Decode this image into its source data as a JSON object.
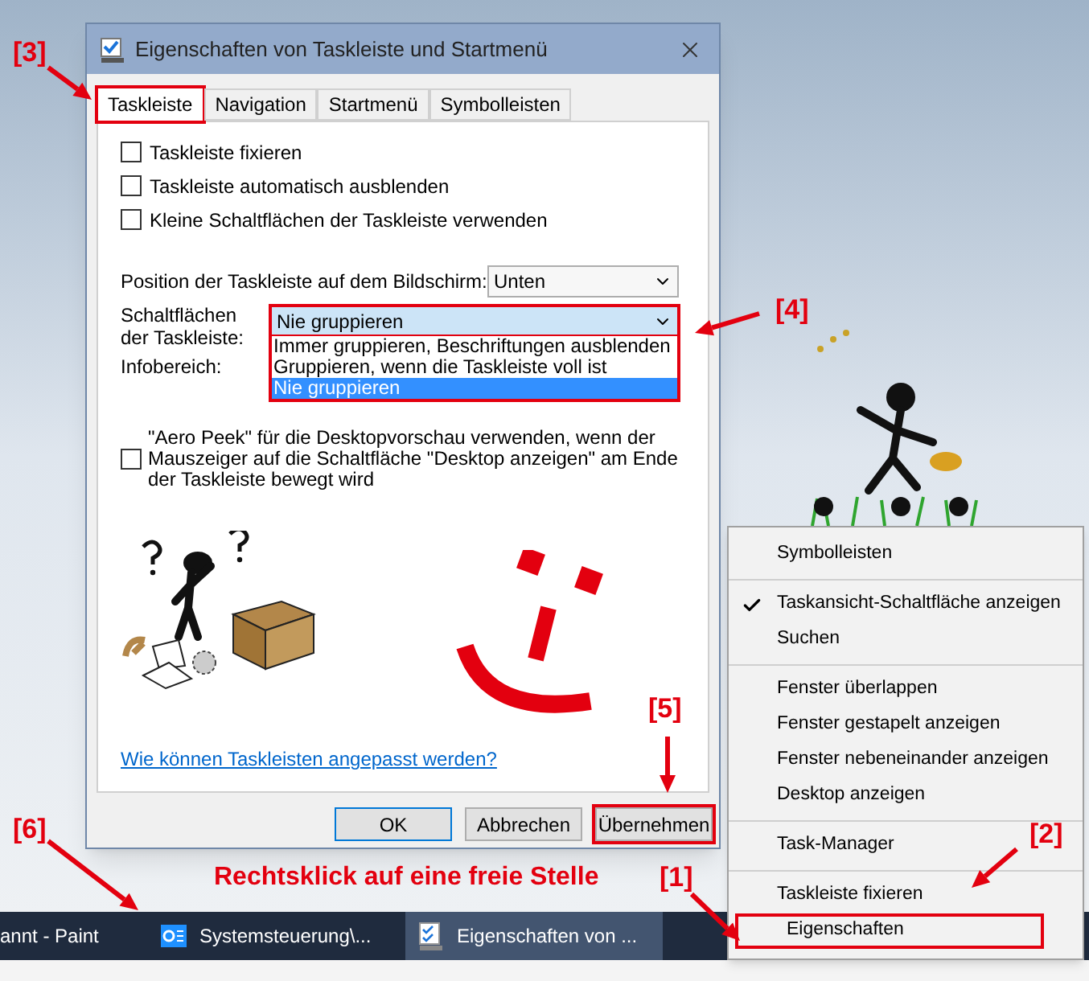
{
  "dialog": {
    "title": "Eigenschaften von Taskleiste und Startmenü",
    "tabs": [
      {
        "label": "Taskleiste",
        "selected": true,
        "marked": true
      },
      {
        "label": "Navigation",
        "selected": false,
        "marked": false
      },
      {
        "label": "Startmenü",
        "selected": false,
        "marked": false
      },
      {
        "label": "Symbolleisten",
        "selected": false,
        "marked": false
      }
    ],
    "checkboxes": [
      {
        "label": "Taskleiste fixieren",
        "checked": false
      },
      {
        "label": "Taskleiste automatisch ausblenden",
        "checked": false
      },
      {
        "label": "Kleine Schaltflächen der Taskleiste verwenden",
        "checked": false
      }
    ],
    "position": {
      "label": "Position der Taskleiste auf dem Bildschirm:",
      "value": "Unten"
    },
    "grouping": {
      "label": "Schaltflächen der Taskleiste:",
      "value": "Nie gruppieren",
      "marked": true,
      "expanded": true,
      "options": [
        {
          "label": "Immer gruppieren, Beschriftungen ausblenden",
          "selected": false
        },
        {
          "label": "Gruppieren, wenn die Taskleiste voll ist",
          "selected": false
        },
        {
          "label": "Nie gruppieren",
          "selected": true
        }
      ]
    },
    "notification_area_label": "Infobereich:",
    "aero_peek": {
      "label": "\"Aero Peek\" für die Desktopvorschau verwenden, wenn der Mauszeiger auf die Schaltfläche \"Desktop anzeigen\" am Ende der Taskleiste bewegt wird",
      "checked": false
    },
    "help_link": "Wie können Taskleisten angepasst werden?",
    "buttons": [
      {
        "label": "OK",
        "default": true,
        "marked": false
      },
      {
        "label": "Abbrechen",
        "default": false,
        "marked": false
      },
      {
        "label": "Übernehmen",
        "default": false,
        "marked": true
      }
    ]
  },
  "context_menu": {
    "sections": [
      {
        "items": [
          {
            "label": "Symbolleisten",
            "checked": false,
            "marked": false
          }
        ]
      },
      {
        "items": [
          {
            "label": "Taskansicht-Schaltfläche anzeigen",
            "checked": true,
            "marked": false
          },
          {
            "label": "Suchen",
            "checked": false,
            "marked": false
          }
        ]
      },
      {
        "items": [
          {
            "label": "Fenster überlappen",
            "checked": false,
            "marked": false
          },
          {
            "label": "Fenster gestapelt anzeigen",
            "checked": false,
            "marked": false
          },
          {
            "label": "Fenster nebeneinander anzeigen",
            "checked": false,
            "marked": false
          },
          {
            "label": "Desktop anzeigen",
            "checked": false,
            "marked": false
          }
        ]
      },
      {
        "items": [
          {
            "label": "Task-Manager",
            "checked": false,
            "marked": false
          }
        ]
      },
      {
        "items": [
          {
            "label": "Taskleiste fixieren",
            "checked": false,
            "marked": false
          },
          {
            "label": "Eigenschaften",
            "checked": false,
            "marked": true
          }
        ]
      }
    ]
  },
  "taskbar": {
    "items": [
      {
        "label": "annt - Paint",
        "kind": "plain",
        "active": false
      },
      {
        "label": "Systemsteuerung\\...",
        "kind": "control-panel",
        "active": false
      },
      {
        "label": "Eigenschaften von ...",
        "kind": "dialog",
        "active": true
      }
    ]
  },
  "annotations": [
    {
      "text": "[3]",
      "arrow": true
    },
    {
      "text": "[4]",
      "arrow": true
    },
    {
      "text": "[5]",
      "arrow": true
    },
    {
      "text": "[6]",
      "arrow": true
    },
    {
      "text": "Rechtsklick auf eine freie Stelle"
    },
    {
      "text": "[1]",
      "arrow": true
    },
    {
      "text": "[2]",
      "arrow": true
    }
  ]
}
